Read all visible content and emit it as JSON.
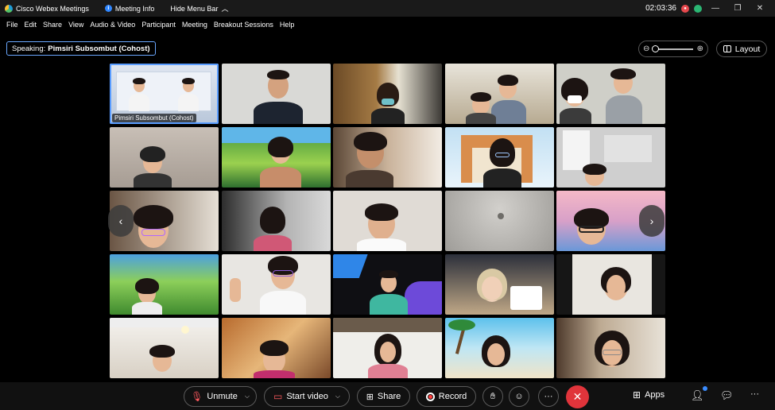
{
  "titlebar": {
    "app_name": "Cisco Webex Meetings",
    "meeting_info": "Meeting Info",
    "hide_menu": "Hide Menu Bar",
    "timer": "02:03:36"
  },
  "menu": [
    "File",
    "Edit",
    "Share",
    "View",
    "Audio & Video",
    "Participant",
    "Meeting",
    "Breakout Sessions",
    "Help"
  ],
  "speaking": {
    "label": "Speaking:",
    "name": "Pimsiri Subsombut (Cohost)"
  },
  "layout_label": "Layout",
  "tile_name": "Pimsiri Subsombut (Cohost)",
  "toolbar": {
    "unmute": "Unmute",
    "start_video": "Start video",
    "share": "Share",
    "record": "Record",
    "apps": "Apps"
  },
  "colors": {
    "accent": "#5a9dff",
    "leave": "#e0343b",
    "mute_icon": "#ff5a5f"
  }
}
